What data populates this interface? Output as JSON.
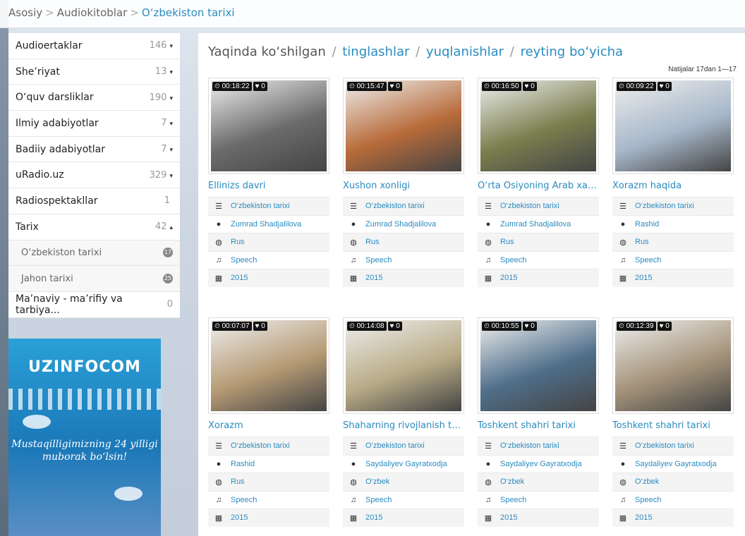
{
  "breadcrumb": [
    "Asosiy",
    "Audiokitoblar",
    "O‘zbekiston tarixi"
  ],
  "sidebar": [
    {
      "label": "Audioertaklar",
      "count": "146",
      "arrow": "▾"
    },
    {
      "label": "She’riyat",
      "count": "13",
      "arrow": "▾"
    },
    {
      "label": "O‘quv darsliklar",
      "count": "190",
      "arrow": "▾"
    },
    {
      "label": "Ilmiy adabiyotlar",
      "count": "7",
      "arrow": "▾"
    },
    {
      "label": "Badiiy adabiyotlar",
      "count": "7",
      "arrow": "▾"
    },
    {
      "label": "uRadio.uz",
      "count": "329",
      "arrow": "▾"
    },
    {
      "label": "Radiospektakllar",
      "count": "1",
      "arrow": ""
    },
    {
      "label": "Tarix",
      "count": "42",
      "arrow": "▴"
    }
  ],
  "sidebar_sub": [
    {
      "label": "O‘zbekiston tarixi",
      "badge": "17"
    },
    {
      "label": "Jahon tarixi",
      "badge": "25"
    }
  ],
  "sidebar_last": {
    "label": "Ma’naviy - ma’rifiy va tarbiya...",
    "count": "0"
  },
  "banner": {
    "logo": "UZINFOCOM",
    "message": "Mustaqilligimizning 24 yilligi muborak bo‘lsin!"
  },
  "heading": {
    "prefix": "Yaqinda ko‘shilgan",
    "links": [
      "tinglashlar",
      "yuqlanishlar",
      "reyting bo‘yicha"
    ]
  },
  "results": "Natijalar 17dan 1—17",
  "cards": [
    {
      "time": "00:18:22",
      "likes": "0",
      "title": "Ellinizs davri",
      "category": "O‘zbekiston tarixi",
      "author": "Zumrad Shadjalilova",
      "lang": "Rus",
      "type": "Speech",
      "year": "2015",
      "tone": "#6b6b6b"
    },
    {
      "time": "00:15:47",
      "likes": "0",
      "title": "Xushon xonligi",
      "category": "O‘zbekiston tarixi",
      "author": "Zumrad Shadjalilova",
      "lang": "Rus",
      "type": "Speech",
      "year": "2015",
      "tone": "#b86b3a"
    },
    {
      "time": "00:16:50",
      "likes": "0",
      "title": "O‘rta Osiyoning Arab xalifal...",
      "category": "O‘zbekiston tarixi",
      "author": "Zumrad Shadjalilova",
      "lang": "Rus",
      "type": "Speech",
      "year": "2015",
      "tone": "#7a7f4e"
    },
    {
      "time": "00:09:22",
      "likes": "0",
      "title": "Xorazm haqida",
      "category": "O‘zbekiston tarixi",
      "author": "Rashid",
      "lang": "Rus",
      "type": "Speech",
      "year": "2015",
      "tone": "#a7b7c9"
    },
    {
      "time": "00:07:07",
      "likes": "0",
      "title": "Xorazm",
      "category": "O‘zbekiston tarixi",
      "author": "Rashid",
      "lang": "Rus",
      "type": "Speech",
      "year": "2015",
      "tone": "#b59a74"
    },
    {
      "time": "00:14:08",
      "likes": "0",
      "title": "Shaharning rivojlanish tarixi",
      "category": "O‘zbekiston tarixi",
      "author": "Saydaliyev Gayratxodja",
      "lang": "O‘zbek",
      "type": "Speech",
      "year": "2015",
      "tone": "#b8ab86"
    },
    {
      "time": "00:10:55",
      "likes": "0",
      "title": "Toshkent shahri tarixi",
      "category": "O‘zbekiston tarixi",
      "author": "Saydaliyev Gayratxodja",
      "lang": "O‘zbek",
      "type": "Speech",
      "year": "2015",
      "tone": "#4f6f8a"
    },
    {
      "time": "00:12:39",
      "likes": "0",
      "title": "Toshkent shahri tarixi",
      "category": "O‘zbekiston tarixi",
      "author": "Saydaliyev Gayratxodja",
      "lang": "O‘zbek",
      "type": "Speech",
      "year": "2015",
      "tone": "#a4937a"
    }
  ],
  "icons": {
    "category": "list-icon",
    "author": "user-icon",
    "lang": "globe-icon",
    "type": "music-icon",
    "year": "calendar-icon",
    "time": "clock-icon",
    "likes": "heart-icon"
  }
}
